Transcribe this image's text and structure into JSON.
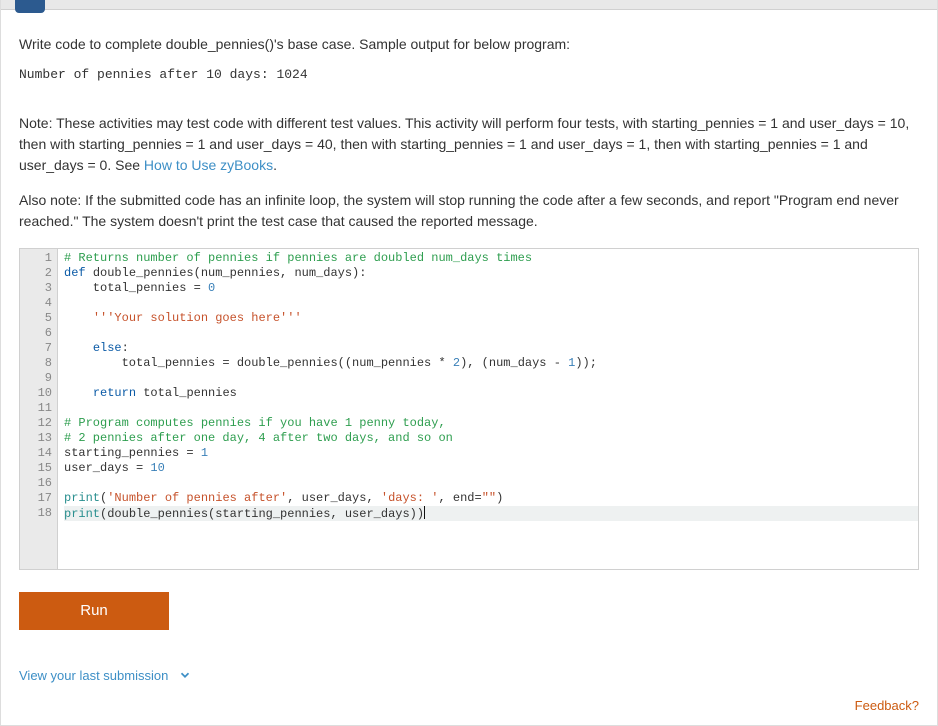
{
  "intro": "Write code to complete double_pennies()'s base case. Sample output for below program:",
  "sample_output": "Number of pennies after 10 days: 1024",
  "note1_prefix": "Note: These activities may test code with different test values. This activity will perform four tests, with starting_pennies = 1 and user_days = 10, then with starting_pennies = 1 and user_days = 40, then with starting_pennies = 1 and user_days = 1, then with starting_pennies = 1 and user_days = 0. See ",
  "note1_link": "How to Use zyBooks",
  "note1_suffix": ".",
  "note2": "Also note: If the submitted code has an infinite loop, the system will stop running the code after a few seconds, and report \"Program end never reached.\" The system doesn't print the test case that caused the reported message.",
  "run_label": "Run",
  "view_last": "View your last submission",
  "feedback": "Feedback?",
  "gutter_count": 18,
  "code_lines": [
    {
      "tokens": [
        {
          "t": "# Returns number of pennies if pennies are doubled num_days times",
          "c": "comment"
        }
      ]
    },
    {
      "tokens": [
        {
          "t": "def ",
          "c": "keyword"
        },
        {
          "t": "double_pennies(num_pennies, num_days):",
          "c": ""
        }
      ]
    },
    {
      "tokens": [
        {
          "t": "    total_pennies = ",
          "c": ""
        },
        {
          "t": "0",
          "c": "number"
        }
      ]
    },
    {
      "tokens": [
        {
          "t": "",
          "c": ""
        }
      ]
    },
    {
      "tokens": [
        {
          "t": "    ",
          "c": ""
        },
        {
          "t": "'''Your solution goes here'''",
          "c": "string"
        }
      ]
    },
    {
      "tokens": [
        {
          "t": "",
          "c": ""
        }
      ]
    },
    {
      "tokens": [
        {
          "t": "    ",
          "c": ""
        },
        {
          "t": "else",
          "c": "keyword"
        },
        {
          "t": ":",
          "c": ""
        }
      ]
    },
    {
      "tokens": [
        {
          "t": "        total_pennies = double_pennies((num_pennies * ",
          "c": ""
        },
        {
          "t": "2",
          "c": "number"
        },
        {
          "t": "), (num_days - ",
          "c": ""
        },
        {
          "t": "1",
          "c": "number"
        },
        {
          "t": "));",
          "c": ""
        }
      ]
    },
    {
      "tokens": [
        {
          "t": "",
          "c": ""
        }
      ]
    },
    {
      "tokens": [
        {
          "t": "    ",
          "c": ""
        },
        {
          "t": "return ",
          "c": "keyword"
        },
        {
          "t": "total_pennies",
          "c": ""
        }
      ]
    },
    {
      "tokens": [
        {
          "t": "",
          "c": ""
        }
      ]
    },
    {
      "tokens": [
        {
          "t": "# Program computes pennies if you have 1 penny today,",
          "c": "comment"
        }
      ]
    },
    {
      "tokens": [
        {
          "t": "# 2 pennies after one day, 4 after two days, and so on",
          "c": "comment"
        }
      ]
    },
    {
      "tokens": [
        {
          "t": "starting_pennies = ",
          "c": ""
        },
        {
          "t": "1",
          "c": "number"
        }
      ]
    },
    {
      "tokens": [
        {
          "t": "user_days = ",
          "c": ""
        },
        {
          "t": "10",
          "c": "number"
        }
      ]
    },
    {
      "tokens": [
        {
          "t": "",
          "c": ""
        }
      ]
    },
    {
      "tokens": [
        {
          "t": "print",
          "c": "builtin"
        },
        {
          "t": "(",
          "c": ""
        },
        {
          "t": "'Number of pennies after'",
          "c": "string"
        },
        {
          "t": ", user_days, ",
          "c": ""
        },
        {
          "t": "'days: '",
          "c": "string"
        },
        {
          "t": ", end=",
          "c": ""
        },
        {
          "t": "\"\"",
          "c": "string"
        },
        {
          "t": ")",
          "c": ""
        }
      ]
    },
    {
      "hl": true,
      "tokens": [
        {
          "t": "print",
          "c": "builtin"
        },
        {
          "t": "(double_pennies(starting_pennies, user_days))",
          "c": ""
        }
      ],
      "cursor": true
    }
  ]
}
